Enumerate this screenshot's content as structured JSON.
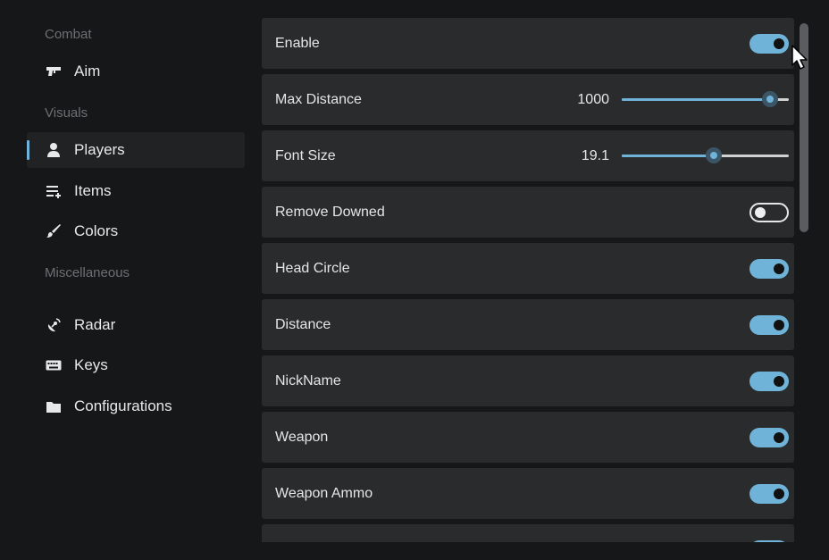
{
  "sidebar": {
    "sections": [
      "Combat",
      "Visuals",
      "Miscellaneous"
    ],
    "items": [
      {
        "label": "Aim",
        "icon": "gun-icon",
        "active": false
      },
      {
        "label": "Players",
        "icon": "person-icon",
        "active": true
      },
      {
        "label": "Items",
        "icon": "list-add-icon",
        "active": false
      },
      {
        "label": "Colors",
        "icon": "brush-icon",
        "active": false
      },
      {
        "label": "Radar",
        "icon": "satellite-icon",
        "active": false
      },
      {
        "label": "Keys",
        "icon": "keyboard-icon",
        "active": false
      },
      {
        "label": "Configurations",
        "icon": "folder-icon",
        "active": false
      }
    ]
  },
  "settings": {
    "enable": {
      "label": "Enable",
      "on": true
    },
    "max_distance": {
      "label": "Max Distance",
      "value": "1000",
      "fraction": 0.89
    },
    "font_size": {
      "label": "Font Size",
      "value": "19.1",
      "fraction": 0.55
    },
    "remove_downed": {
      "label": "Remove Downed",
      "on": false
    },
    "head_circle": {
      "label": "Head Circle",
      "on": true
    },
    "distance": {
      "label": "Distance",
      "on": true
    },
    "nickname": {
      "label": "NickName",
      "on": true
    },
    "weapon": {
      "label": "Weapon",
      "on": true
    },
    "weapon_ammo": {
      "label": "Weapon Ammo",
      "on": true
    }
  },
  "colors": {
    "accent": "#6fb3d8",
    "row_bg": "#2a2b2d",
    "bg": "#161718"
  }
}
